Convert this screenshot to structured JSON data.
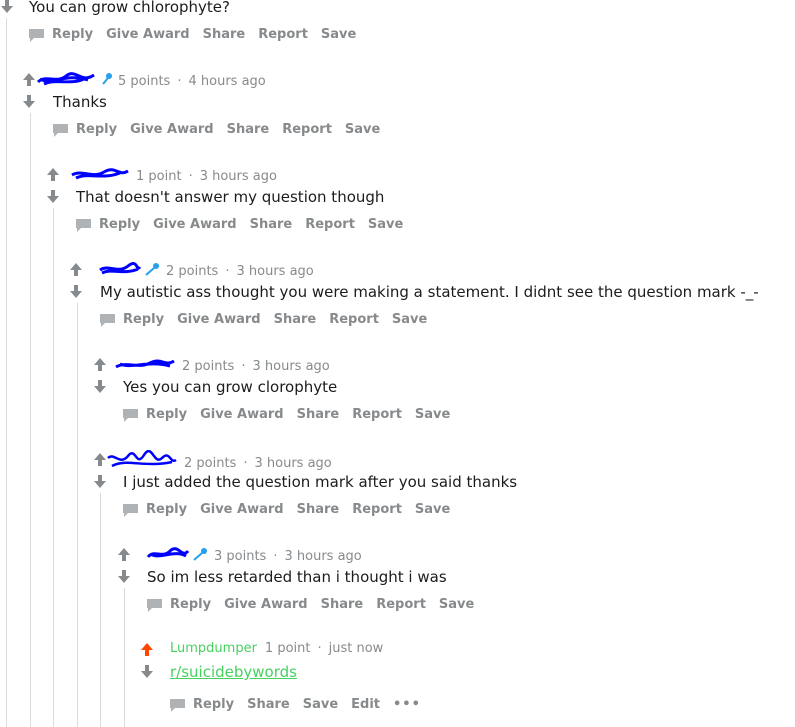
{
  "comments": [
    {
      "body": "You can grow chlorophyte?",
      "actions": [
        "Reply",
        "Give Award",
        "Share",
        "Report",
        "Save"
      ]
    },
    {
      "points": "5 points",
      "time": "4 hours ago",
      "body": "Thanks",
      "actions": [
        "Reply",
        "Give Award",
        "Share",
        "Report",
        "Save"
      ]
    },
    {
      "points": "1 point",
      "time": "3 hours ago",
      "body": "That doesn't answer my question though",
      "actions": [
        "Reply",
        "Give Award",
        "Share",
        "Report",
        "Save"
      ]
    },
    {
      "points": "2 points",
      "time": "3 hours ago",
      "body": "My autistic ass thought you were making a statement. I didnt see the question mark -_-",
      "actions": [
        "Reply",
        "Give Award",
        "Share",
        "Report",
        "Save"
      ]
    },
    {
      "points": "2 points",
      "time": "3 hours ago",
      "body": "Yes you can grow clorophyte",
      "actions": [
        "Reply",
        "Give Award",
        "Share",
        "Report",
        "Save"
      ]
    },
    {
      "points": "2 points",
      "time": "3 hours ago",
      "body": "I just added the question mark after you said thanks",
      "actions": [
        "Reply",
        "Give Award",
        "Share",
        "Report",
        "Save"
      ]
    },
    {
      "points": "3 points",
      "time": "3 hours ago",
      "body": "So im less retarded than i thought i was",
      "actions": [
        "Reply",
        "Give Award",
        "Share",
        "Report",
        "Save"
      ]
    },
    {
      "author": "Lumpdumper",
      "points": "1 point",
      "time": "just now",
      "body_link": "r/suicidebywords",
      "actions": [
        "Reply",
        "Share",
        "Save",
        "Edit"
      ],
      "more": "•••"
    }
  ],
  "separator": "·",
  "colors": {
    "meta": "#878a8c",
    "text": "#1c1c1c",
    "thread_line": "#dadada",
    "upvoted": "#ff4500",
    "own_author": "#46d160",
    "link": "#46d160",
    "scribble": "#0000ff",
    "mic": "#24a0ed"
  }
}
